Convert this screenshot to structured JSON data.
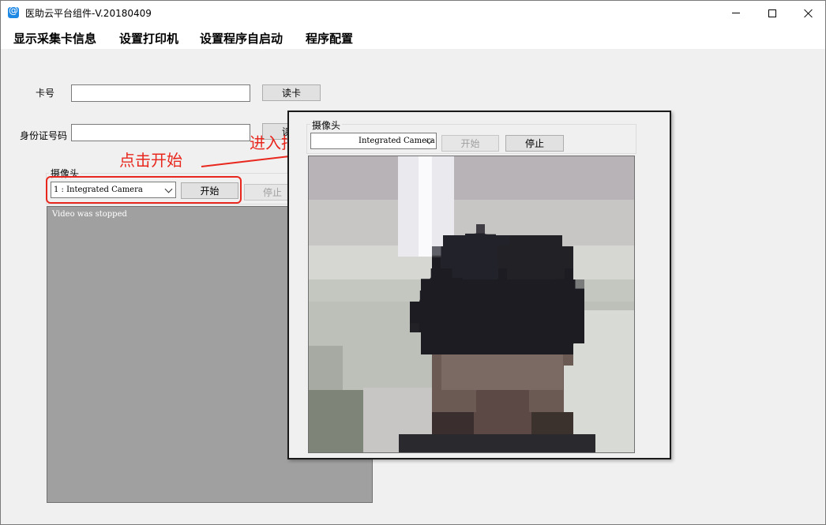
{
  "window": {
    "title": "医助云平台组件-V.20180409"
  },
  "menu": {
    "items": [
      "显示采集卡信息",
      "设置打印机",
      "设置程序自启动",
      "程序配置"
    ]
  },
  "form": {
    "card_label": "卡号",
    "card_value": "",
    "read_card_button": "读卡",
    "id_label": "身份证号码",
    "id_value": "",
    "read_id_button": "读身"
  },
  "camera": {
    "group_title": "摄像头",
    "device": "1 : Integrated Camera",
    "start_button": "开始",
    "stop_button": "停止",
    "status_text": "Video was stopped"
  },
  "popup": {
    "group_title": "摄像头",
    "device": "Integrated Camera",
    "start_button": "开始",
    "stop_button": "停止"
  },
  "annotations": {
    "click_start": "点击开始",
    "enter_capture": "进入拍照状态",
    "color": "#e8281e"
  }
}
